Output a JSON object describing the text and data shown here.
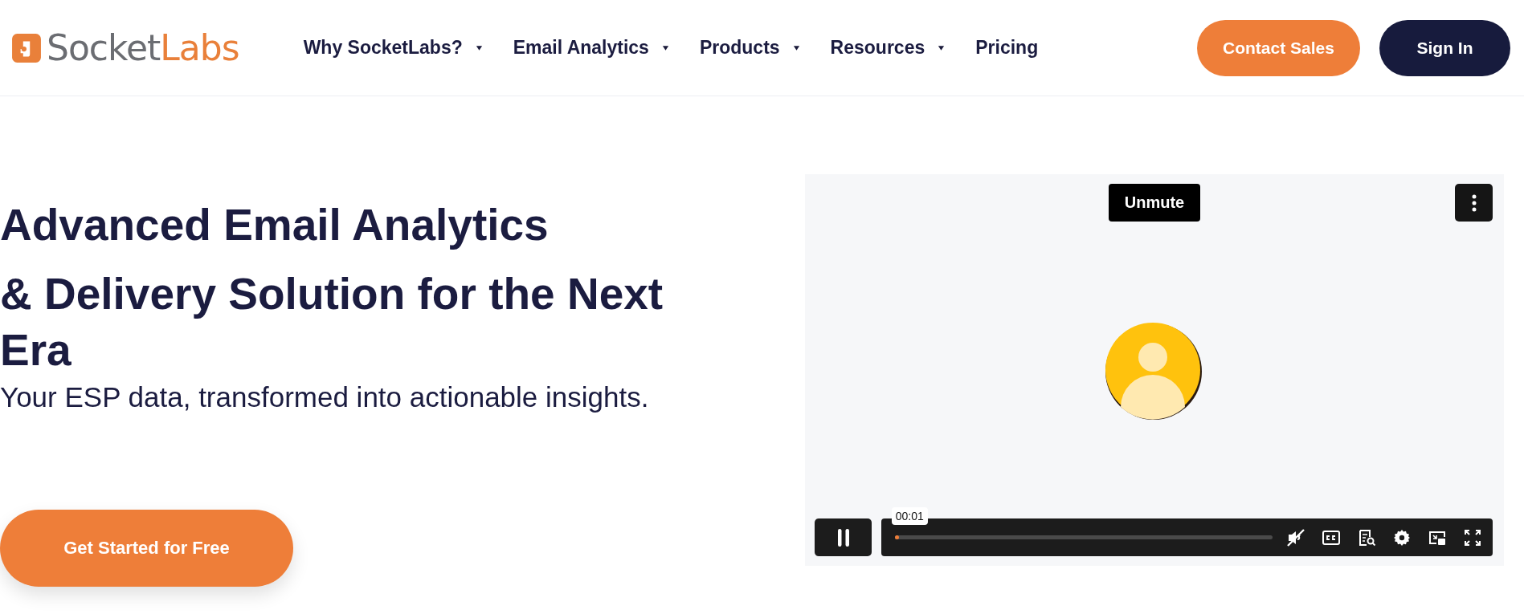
{
  "header": {
    "logo": {
      "first": "Socket",
      "second": "Labs"
    },
    "nav": [
      {
        "label": "Why SocketLabs?",
        "dropdown": true
      },
      {
        "label": "Email Analytics",
        "dropdown": true
      },
      {
        "label": "Products",
        "dropdown": true
      },
      {
        "label": "Resources",
        "dropdown": true
      },
      {
        "label": "Pricing",
        "dropdown": false
      }
    ],
    "buttons": [
      {
        "label": "Contact Sales",
        "kind": "primary"
      },
      {
        "label": "Sign In",
        "kind": "dark"
      }
    ]
  },
  "hero": {
    "headings": [
      "Advanced Email Analytics",
      "& Delivery Solution for the Next Era"
    ],
    "subtitle": "Your ESP data, transformed into actionable insights.",
    "cta": "Get Started for Free"
  },
  "video": {
    "unmute": "Unmute",
    "time": "00:01",
    "playing": true,
    "progress": {
      "level": 0.01
    }
  }
}
